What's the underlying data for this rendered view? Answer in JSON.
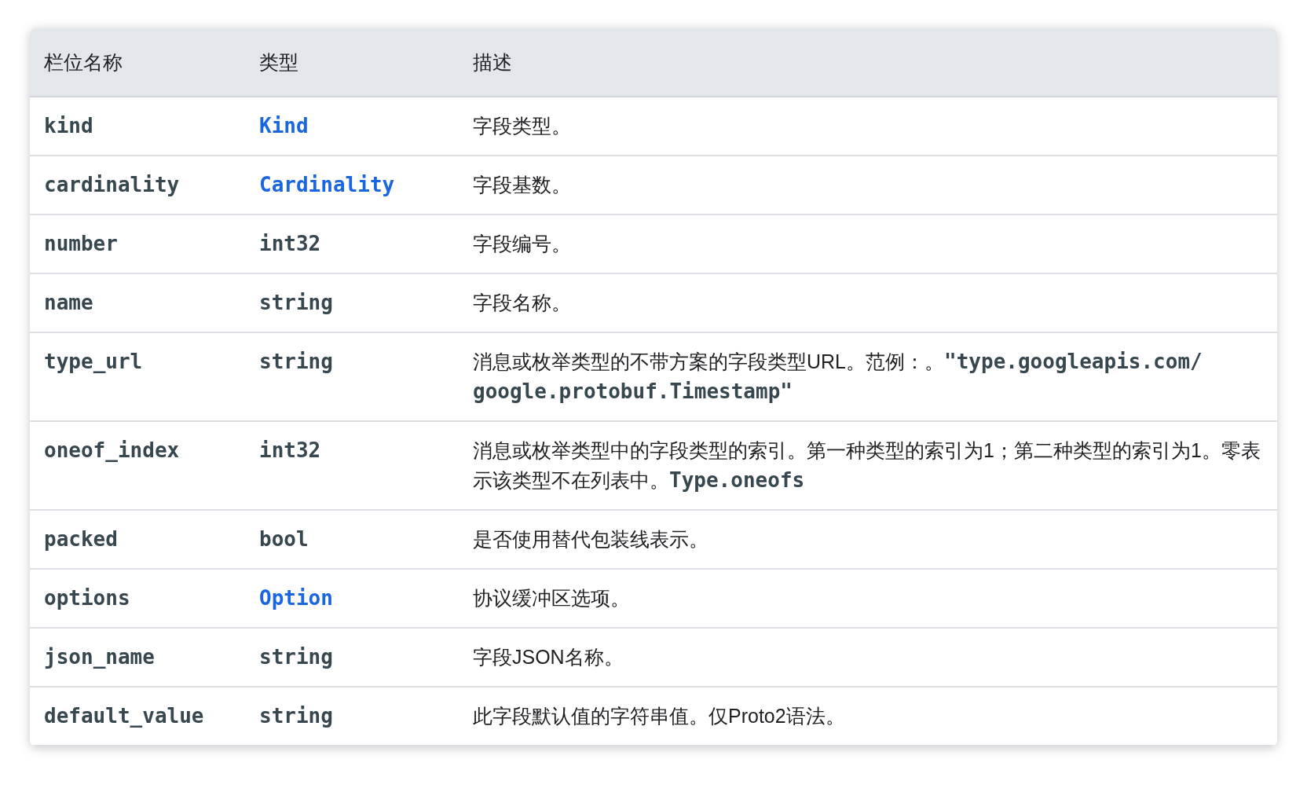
{
  "table": {
    "columns": [
      "栏位名称",
      "类型",
      "描述"
    ],
    "rows": [
      {
        "name": "kind",
        "type": {
          "text": "Kind",
          "link": true
        },
        "description": [
          {
            "kind": "plain",
            "text": "字段类型。"
          }
        ]
      },
      {
        "name": "cardinality",
        "type": {
          "text": "Cardinality",
          "link": true
        },
        "description": [
          {
            "kind": "plain",
            "text": "字段基数。"
          }
        ]
      },
      {
        "name": "number",
        "type": {
          "text": "int32",
          "link": false
        },
        "description": [
          {
            "kind": "plain",
            "text": "字段编号。"
          }
        ]
      },
      {
        "name": "name",
        "type": {
          "text": "string",
          "link": false
        },
        "description": [
          {
            "kind": "plain",
            "text": "字段名称。"
          }
        ]
      },
      {
        "name": "type_url",
        "type": {
          "text": "string",
          "link": false
        },
        "description": [
          {
            "kind": "plain",
            "text": "消息或枚举类型的不带方案的字段类型URL。范例：。"
          },
          {
            "kind": "code",
            "text": "\"type.googleapis.com/google.protobuf.Timestamp\""
          }
        ]
      },
      {
        "name": "oneof_index",
        "type": {
          "text": "int32",
          "link": false
        },
        "description": [
          {
            "kind": "plain",
            "text": "消息或枚举类型中的字段类型的索引。第一种类型的索引为1；第二种类型的索引为1。零表示该类型不在列表中。"
          },
          {
            "kind": "code",
            "text": "Type.oneofs"
          }
        ]
      },
      {
        "name": "packed",
        "type": {
          "text": "bool",
          "link": false
        },
        "description": [
          {
            "kind": "plain",
            "text": "是否使用替代包装线表示。"
          }
        ]
      },
      {
        "name": "options",
        "type": {
          "text": "Option",
          "link": true
        },
        "description": [
          {
            "kind": "plain",
            "text": "协议缓冲区选项。"
          }
        ]
      },
      {
        "name": "json_name",
        "type": {
          "text": "string",
          "link": false
        },
        "description": [
          {
            "kind": "plain",
            "text": "字段JSON名称。"
          }
        ]
      },
      {
        "name": "default_value",
        "type": {
          "text": "string",
          "link": false
        },
        "description": [
          {
            "kind": "plain",
            "text": "此字段默认值的字符串值。仅Proto2语法。"
          }
        ]
      }
    ]
  }
}
